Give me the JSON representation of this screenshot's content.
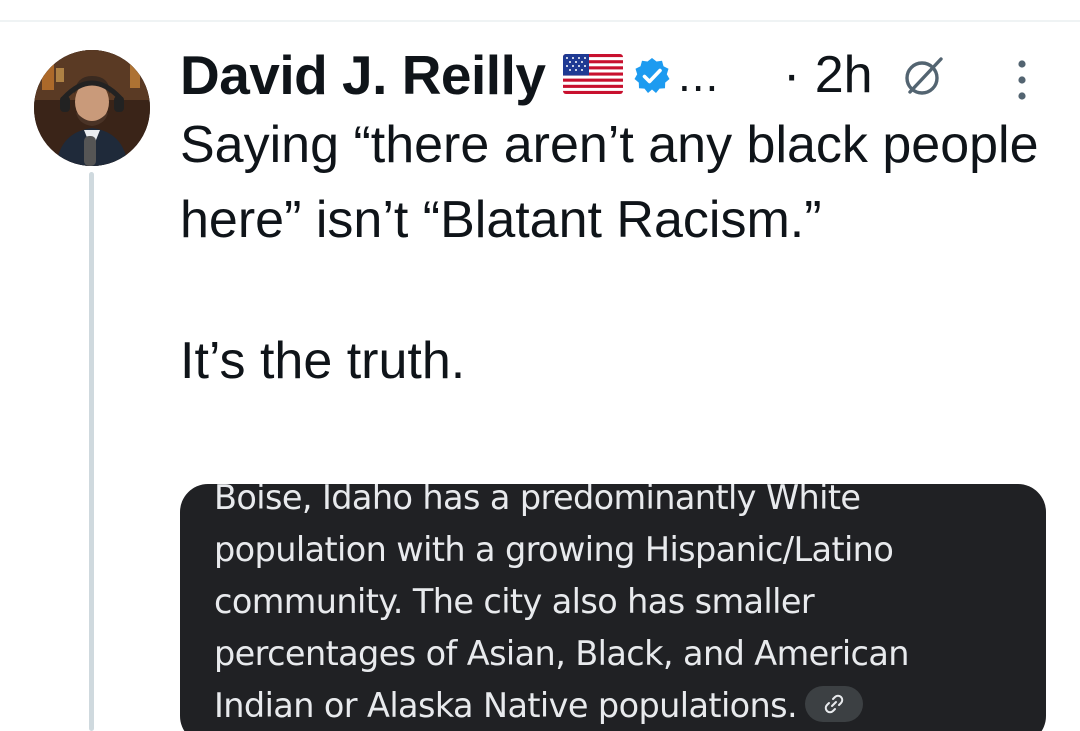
{
  "post": {
    "author_name": "David J. Reilly",
    "overflow": "...",
    "timestamp": "· 2h",
    "icons": {
      "flag": "us-flag-icon",
      "verified": "verified-badge-icon",
      "grok": "grok-icon",
      "more": "more-options-icon"
    },
    "text": [
      "Saying “there aren’t any black people here” isn’t “Blatant Racism.”",
      "It’s the truth."
    ]
  },
  "card": {
    "lines": [
      "Boise, Idaho has a predominantly White",
      "population with a growing Hispanic/Latino",
      "community. The city also has smaller",
      "percentages of Asian, Black, and American",
      "Indian or Alaska Native populations."
    ],
    "link_icon": "link-icon"
  },
  "colors": {
    "verified": "#1d9bf0",
    "thread_line": "#cfd9de",
    "card_background": "#202124",
    "card_text": "#e8eaed"
  }
}
